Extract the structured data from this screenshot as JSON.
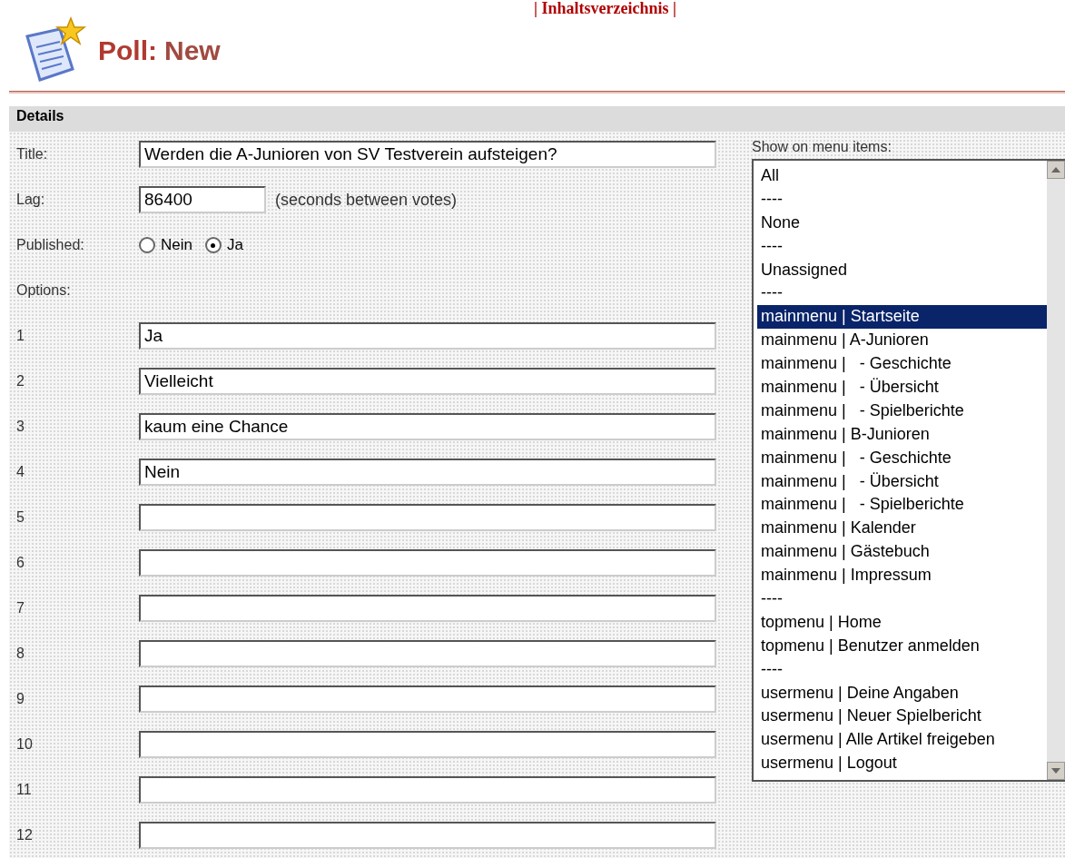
{
  "top_link": "| Inhaltsverzeichnis |",
  "header": {
    "title_bold": "Poll:",
    "title_rest": "New"
  },
  "details": {
    "heading": "Details",
    "title": {
      "label": "Title:",
      "value": "Werden die A-Junioren von SV Testverein aufsteigen?"
    },
    "lag": {
      "label": "Lag:",
      "value": "86400",
      "hint": "(seconds between votes)"
    },
    "published": {
      "label": "Published:",
      "choices": [
        {
          "label": "Nein",
          "selected": false
        },
        {
          "label": "Ja",
          "selected": true
        }
      ]
    },
    "options_label": "Options:",
    "options": [
      {
        "number": "1",
        "value": "Ja"
      },
      {
        "number": "2",
        "value": "Vielleicht"
      },
      {
        "number": "3",
        "value": "kaum eine Chance"
      },
      {
        "number": "4",
        "value": "Nein"
      },
      {
        "number": "5"
      },
      {
        "number": "6"
      },
      {
        "number": "7"
      },
      {
        "number": "8"
      },
      {
        "number": "9"
      },
      {
        "number": "10"
      },
      {
        "number": "11"
      },
      {
        "number": "12"
      }
    ],
    "menu_items": {
      "label": "Show on menu items:",
      "items": [
        {
          "text": "All",
          "selected": false
        },
        {
          "text": "----",
          "selected": false
        },
        {
          "text": "None",
          "selected": false
        },
        {
          "text": "----",
          "selected": false
        },
        {
          "text": "Unassigned",
          "selected": false
        },
        {
          "text": "----",
          "selected": false
        },
        {
          "text": "mainmenu | Startseite",
          "selected": true
        },
        {
          "text": "mainmenu | A-Junioren",
          "selected": false
        },
        {
          "text": "mainmenu |   - Geschichte",
          "selected": false
        },
        {
          "text": "mainmenu |   - Übersicht",
          "selected": false
        },
        {
          "text": "mainmenu |   - Spielberichte",
          "selected": false
        },
        {
          "text": "mainmenu | B-Junioren",
          "selected": false
        },
        {
          "text": "mainmenu |   - Geschichte",
          "selected": false
        },
        {
          "text": "mainmenu |   - Übersicht",
          "selected": false
        },
        {
          "text": "mainmenu |   - Spielberichte",
          "selected": false
        },
        {
          "text": "mainmenu | Kalender",
          "selected": false
        },
        {
          "text": "mainmenu | Gästebuch",
          "selected": false
        },
        {
          "text": "mainmenu | Impressum",
          "selected": false
        },
        {
          "text": "----",
          "selected": false
        },
        {
          "text": "topmenu | Home",
          "selected": false
        },
        {
          "text": "topmenu | Benutzer anmelden",
          "selected": false
        },
        {
          "text": "----",
          "selected": false
        },
        {
          "text": "usermenu | Deine Angaben",
          "selected": false
        },
        {
          "text": "usermenu | Neuer Spielbericht",
          "selected": false
        },
        {
          "text": "usermenu | Alle Artikel freigeben",
          "selected": false
        },
        {
          "text": "usermenu | Logout",
          "selected": false
        }
      ]
    }
  }
}
